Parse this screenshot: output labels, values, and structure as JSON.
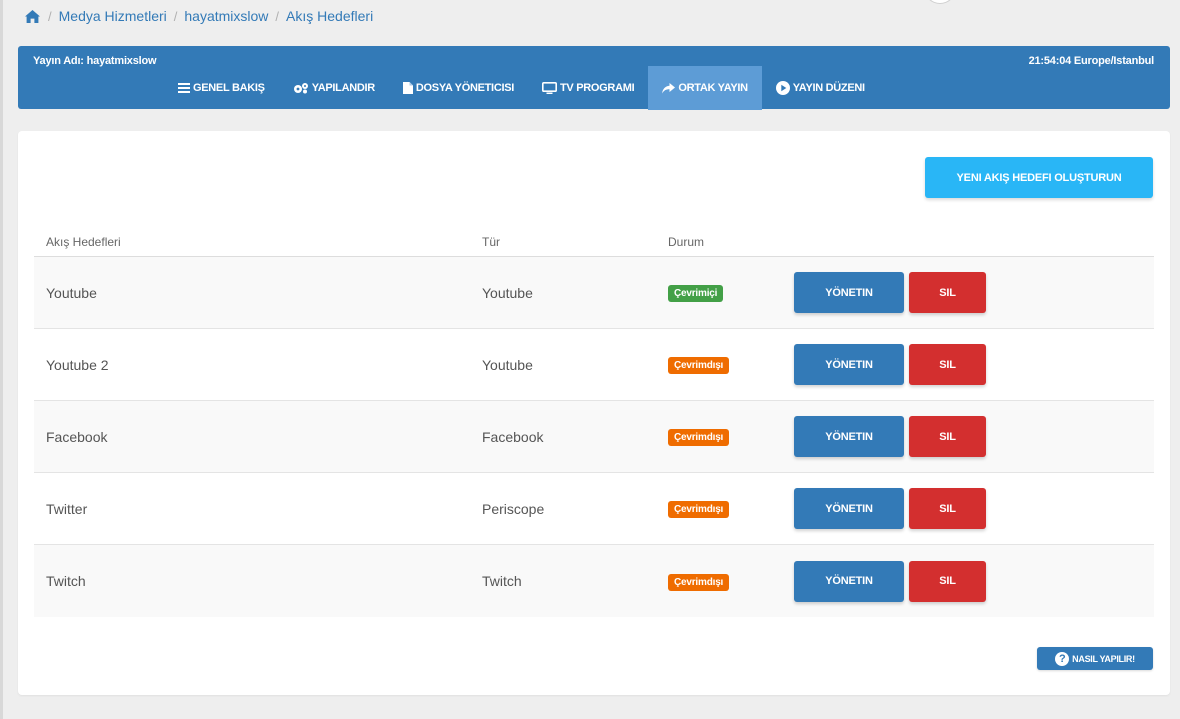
{
  "breadcrumb": {
    "home_icon": "home-icon",
    "items": [
      "Medya Hizmetleri",
      "hayatmixslow",
      "Akış Hedefleri"
    ]
  },
  "header": {
    "stream_name": "Yayın Adı: hayatmixslow",
    "clock": "21:54:04 Europe/Istanbul"
  },
  "nav": [
    {
      "label": "GENEL BAKIŞ",
      "icon": "list-icon"
    },
    {
      "label": "YAPILANDIR",
      "icon": "gears-icon"
    },
    {
      "label": "DOSYA YÖNETICISI",
      "icon": "file-icon"
    },
    {
      "label": "TV PROGRAMI",
      "icon": "monitor-icon"
    },
    {
      "label": "ORTAK YAYIN",
      "icon": "share-arrow-icon",
      "active": true
    },
    {
      "label": "YAYIN DÜZENI",
      "icon": "play-circle-icon"
    }
  ],
  "create_button": "YENI AKIŞ HEDEFI OLUŞTURUN",
  "table": {
    "headers": {
      "name": "Akış Hedefleri",
      "type": "Tür",
      "status": "Durum"
    },
    "rows": [
      {
        "name": "Youtube",
        "type": "Youtube",
        "status": "Çevrimiçi",
        "online": true
      },
      {
        "name": "Youtube 2",
        "type": "Youtube",
        "status": "Çevrimdışı",
        "online": false
      },
      {
        "name": "Facebook",
        "type": "Facebook",
        "status": "Çevrimdışı",
        "online": false
      },
      {
        "name": "Twitter",
        "type": "Periscope",
        "status": "Çevrimdışı",
        "online": false
      },
      {
        "name": "Twitch",
        "type": "Twitch",
        "status": "Çevrimdışı",
        "online": false
      }
    ],
    "manage_label": "YÖNETIN",
    "delete_label": "SIL"
  },
  "help_button": "NASIL YAPILIR!",
  "colors": {
    "primary": "#337ab7",
    "nav_active": "#5d9cd6",
    "create": "#29b6f6",
    "online": "#43a047",
    "offline": "#ef6c00",
    "delete": "#d32f2f"
  }
}
